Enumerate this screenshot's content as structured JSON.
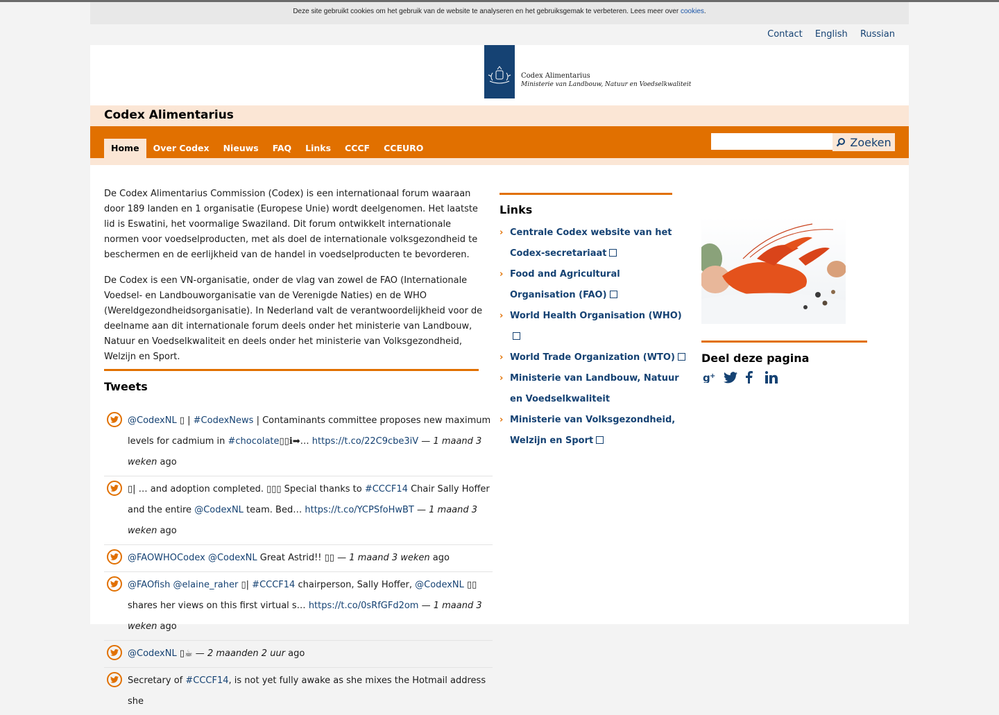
{
  "cookie_bar": {
    "text": "Deze site gebruikt cookies om het gebruik van de website te analyseren en het gebruiksgemak te verbeteren. Lees meer over",
    "link": "cookies",
    "end": "."
  },
  "top_links": [
    "Contact",
    "English",
    "Russian"
  ],
  "logo": {
    "line1": "Codex Alimentarius",
    "line2": "Ministerie van Landbouw, Natuur en Voedselkwaliteit"
  },
  "site_title": "Codex Alimentarius",
  "nav": {
    "items": [
      "Home",
      "Over Codex",
      "Nieuws",
      "FAQ",
      "Links",
      "CCCF",
      "CCEURO"
    ],
    "active": "Home"
  },
  "search": {
    "button": "Zoeken",
    "value": ""
  },
  "intro": [
    "De Codex Alimentarius Commission (Codex) is een internationaal forum waaraan door 189 landen en 1 organisatie (Europese Unie) wordt deelgenomen. Het laatste lid is Eswatini, het voormalige Swaziland. Dit forum ontwikkelt internationale normen voor voedselproducten, met als doel de internationale volksgezondheid te beschermen en de eerlijkheid van de handel in voedselproducten te bevorderen.",
    "De Codex is een VN-organisatie, onder de vlag van zowel de FAO (Internationale Voedsel- en Landbouworganisatie van de Verenigde Naties) en de WHO (Wereldgezondheidsorganisatie). In Nederland valt de verantwoordelijkheid voor de deelname aan dit internationale forum deels onder het ministerie van Landbouw, Natuur en Voedselkwaliteit en deels onder het ministerie van Volksgezondheid, Welzijn en Sport."
  ],
  "tweets_title": "Tweets",
  "tweets": [
    {
      "p1": "@CodexNL",
      "p2": " ▯ | ",
      "p3": "#CodexNews",
      "p4": " | Contaminants committee proposes new maximum levels for cadmium in ",
      "p5": "#chocolate",
      "p6": "▯▯ℹ➡… ",
      "p7": "https://t.co/22C9cbe3iV",
      "p8": " — ",
      "time": "1 maand 3 weken",
      "ago": " ago"
    },
    {
      "p1": "▯| … and adoption completed. ▯▯▯ Special thanks to ",
      "p2": "#CCCF14",
      "p3": " Chair Sally Hoffer and the entire ",
      "p4": "@CodexNL",
      "p5": " team. Bed… ",
      "p6": "https://t.co/YCPSfoHwBT",
      "p7": " — ",
      "time": "1 maand 3 weken",
      "ago": " ago"
    },
    {
      "p1": "@FAOWHOCodex",
      "p2": " ",
      "p3": "@CodexNL",
      "p4": " Great Astrid!! ▯▯ — ",
      "time": "1 maand 3 weken",
      "ago": " ago"
    },
    {
      "p1": "@FAOfish",
      "p2": " ",
      "p3": "@elaine_raher",
      "p4": " ▯| ",
      "p5": "#CCCF14",
      "p6": " chairperson, Sally Hoffer, ",
      "p7": "@CodexNL",
      "p8": " ▯▯ shares her views on this first virtual s… ",
      "p9": "https://t.co/0sRfGFd2om",
      "p10": " — ",
      "time": "1 maand 3 weken",
      "ago": " ago"
    },
    {
      "p1": "@CodexNL",
      "p2": " ▯☕ — ",
      "time": "2 maanden 2 uur",
      "ago": " ago"
    },
    {
      "p1": "Secretary of ",
      "p2": "#CCCF14",
      "p3": ", is not yet fully awake as she mixes the Hotmail address she"
    }
  ],
  "links_title": "Links",
  "links": [
    "Centrale Codex website van het Codex-secretariaat",
    "Food and Agricultural Organisation (FAO)",
    "World Health Organisation (WHO)",
    "World Trade Organization (WTO)",
    "Ministerie van Landbouw, Natuur en Voedselkwaliteit",
    "Ministerie van Volksgezondheid, Welzijn en Sport"
  ],
  "share_title": "Deel deze pagina",
  "share_icons": [
    "google-plus-icon",
    "twitter-icon",
    "facebook-icon",
    "linkedin-icon"
  ],
  "colors": {
    "accent": "#e17000",
    "brand": "#154273",
    "tint": "#fbe6d5"
  }
}
